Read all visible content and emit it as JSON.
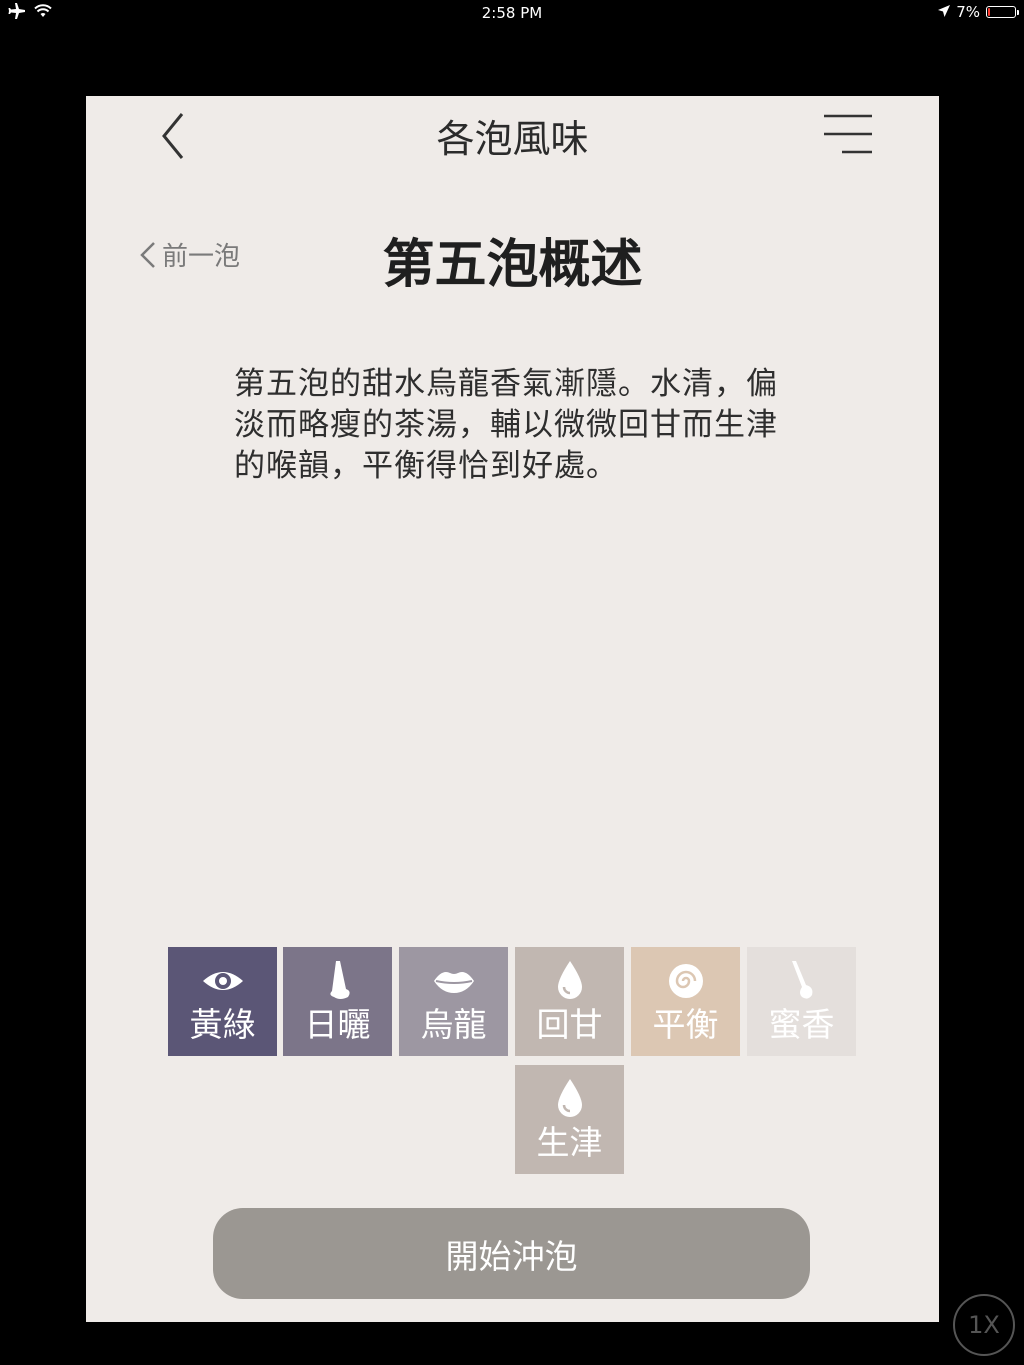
{
  "status_bar": {
    "time": "2:58 PM",
    "battery_text": "7%",
    "battery_level": 0.07,
    "icons": [
      "airplane-icon",
      "wifi-icon",
      "location-arrow-icon",
      "battery-icon"
    ]
  },
  "header": {
    "title": "各泡風味",
    "back_icon": "chevron-left-icon",
    "menu_icon": "menu-icon"
  },
  "section": {
    "prev_label": "前一泡",
    "title": "第五泡概述",
    "description": "第五泡的甜水烏龍香氣漸隱。水清，偏淡而略瘦的茶湯，輔以微微回甘而生津的喉韻，平衡得恰到好處。"
  },
  "tiles": [
    {
      "label": "黃綠",
      "icon": "eye-icon",
      "color": "#5b5676"
    },
    {
      "label": "日曬",
      "icon": "nose-icon",
      "color": "#7c7589"
    },
    {
      "label": "烏龍",
      "icon": "lips-icon",
      "color": "#9d97a2"
    },
    {
      "label": "回甘",
      "icon": "droplet-icon",
      "color": "#c1b7b1"
    },
    {
      "label": "平衡",
      "icon": "swirl-icon",
      "color": "#dcc7b3"
    },
    {
      "label": "蜜香",
      "icon": "spoon-icon",
      "color": "#e4dfdc"
    },
    {
      "label": "生津",
      "icon": "droplet-icon",
      "color": "#c1b7b1"
    }
  ],
  "actions": {
    "start_label": "開始沖泡",
    "button_color": "#9b9792"
  },
  "overlay": {
    "zoom_label": "1X"
  }
}
